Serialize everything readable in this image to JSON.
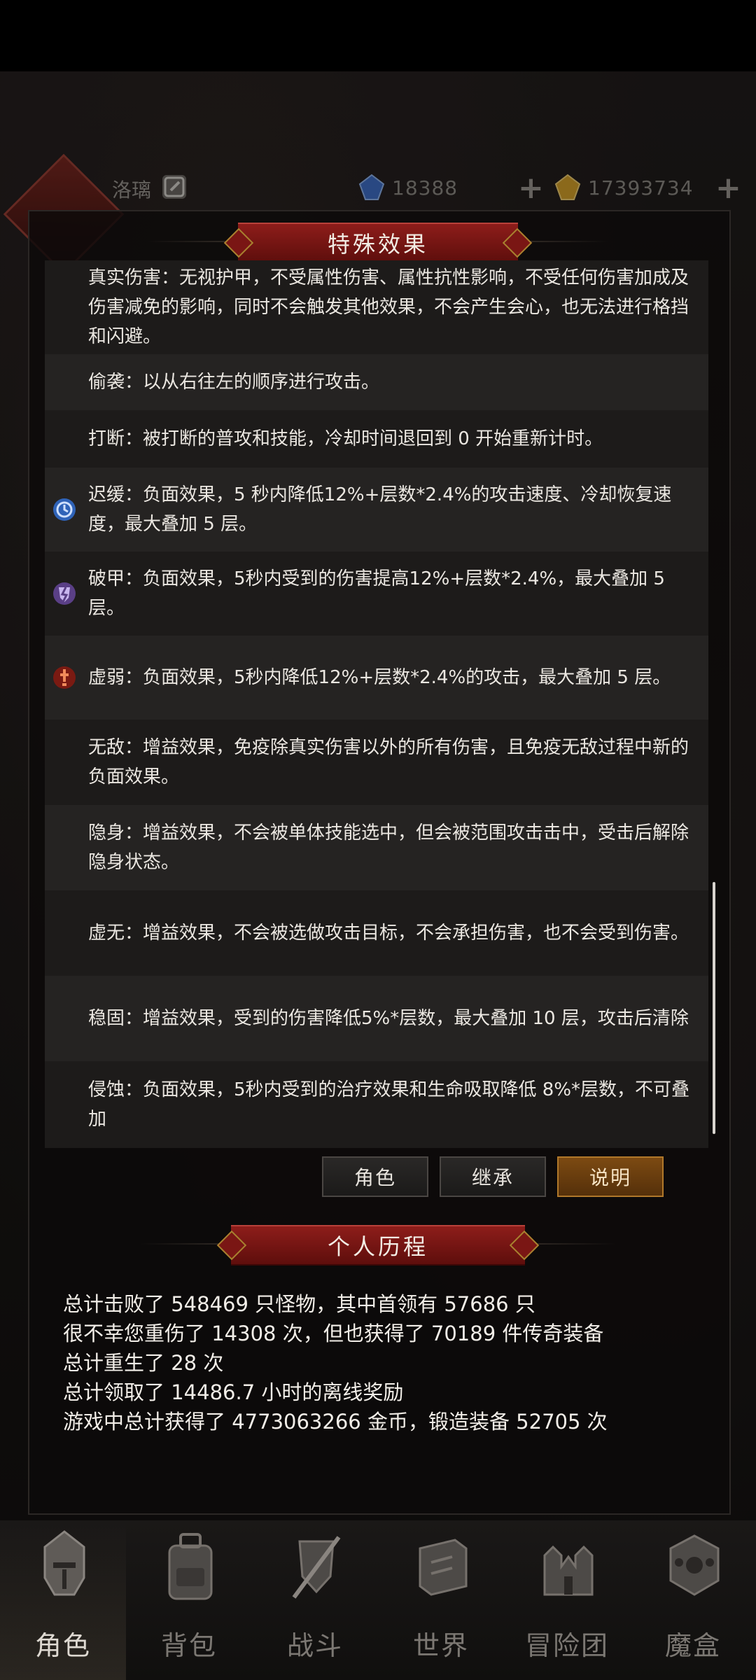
{
  "user": {
    "name": "洛璃"
  },
  "resources": [
    {
      "icon": "blue-gem-icon",
      "value": "18388",
      "color": "#3f6fc8"
    },
    {
      "icon": "gold-gem-icon",
      "value": "17393734",
      "color": "#d6a22a"
    }
  ],
  "effects_panel": {
    "title": "特殊效果",
    "items": [
      {
        "text": "真实伤害：无视护甲，不受属性伤害、属性抗性影响，不受任何伤害加成及伤害减免的影响，同时不会触发其他效果，不会产生会心，也无法进行格挡和闪避。",
        "icon": ""
      },
      {
        "text": "偷袭：以从右往左的顺序进行攻击。",
        "icon": ""
      },
      {
        "text": "打断：被打断的普攻和技能，冷却时间退回到 0 开始重新计时。",
        "icon": ""
      },
      {
        "text": "迟缓：负面效果，5 秒内降低12%+层数*2.4%的攻击速度、冷却恢复速度，最大叠加 5 层。",
        "icon": "slow-clock-icon"
      },
      {
        "text": "破甲：负面效果，5秒内受到的伤害提高12%+层数*2.4%，最大叠加 5 层。",
        "icon": "broken-shield-icon"
      },
      {
        "text": "虚弱：负面效果，5秒内降低12%+层数*2.4%的攻击，最大叠加 5 层。",
        "icon": "weak-sword-icon"
      },
      {
        "text": "无敌：增益效果，免疫除真实伤害以外的所有伤害，且免疫无敌过程中新的负面效果。",
        "icon": ""
      },
      {
        "text": "隐身：增益效果，不会被单体技能选中，但会被范围攻击击中，受击后解除隐身状态。",
        "icon": ""
      },
      {
        "text": "虚无：增益效果，不会被选做攻击目标，不会承担伤害，也不会受到伤害。",
        "icon": ""
      },
      {
        "text": "稳固：增益效果，受到的伤害降低5%*层数，最大叠加 10 层，攻击后清除",
        "icon": ""
      },
      {
        "text": "侵蚀：负面效果，5秒内受到的治疗效果和生命吸取降低 8%*层数，不可叠加",
        "icon": ""
      }
    ]
  },
  "tabs": [
    {
      "label": "角色",
      "active": false
    },
    {
      "label": "继承",
      "active": false
    },
    {
      "label": "说明",
      "active": true
    }
  ],
  "history": {
    "title": "个人历程",
    "lines": [
      "总计击败了 548469 只怪物，其中首领有 57686 只",
      "很不幸您重伤了 14308 次，但也获得了 70189 件传奇装备",
      "总计重生了 28 次",
      "总计领取了 14486.7 小时的离线奖励",
      "游戏中总计获得了 4773063266 金币，锻造装备 52705 次"
    ]
  },
  "bottom_nav": [
    {
      "label": "角色",
      "icon": "helmet-icon",
      "active": true
    },
    {
      "label": "背包",
      "icon": "backpack-icon",
      "active": false
    },
    {
      "label": "战斗",
      "icon": "swords-shield-icon",
      "active": false
    },
    {
      "label": "世界",
      "icon": "map-scroll-icon",
      "active": false
    },
    {
      "label": "冒险团",
      "icon": "castle-icon",
      "active": false
    },
    {
      "label": "魔盒",
      "icon": "magic-box-icon",
      "active": false
    }
  ]
}
